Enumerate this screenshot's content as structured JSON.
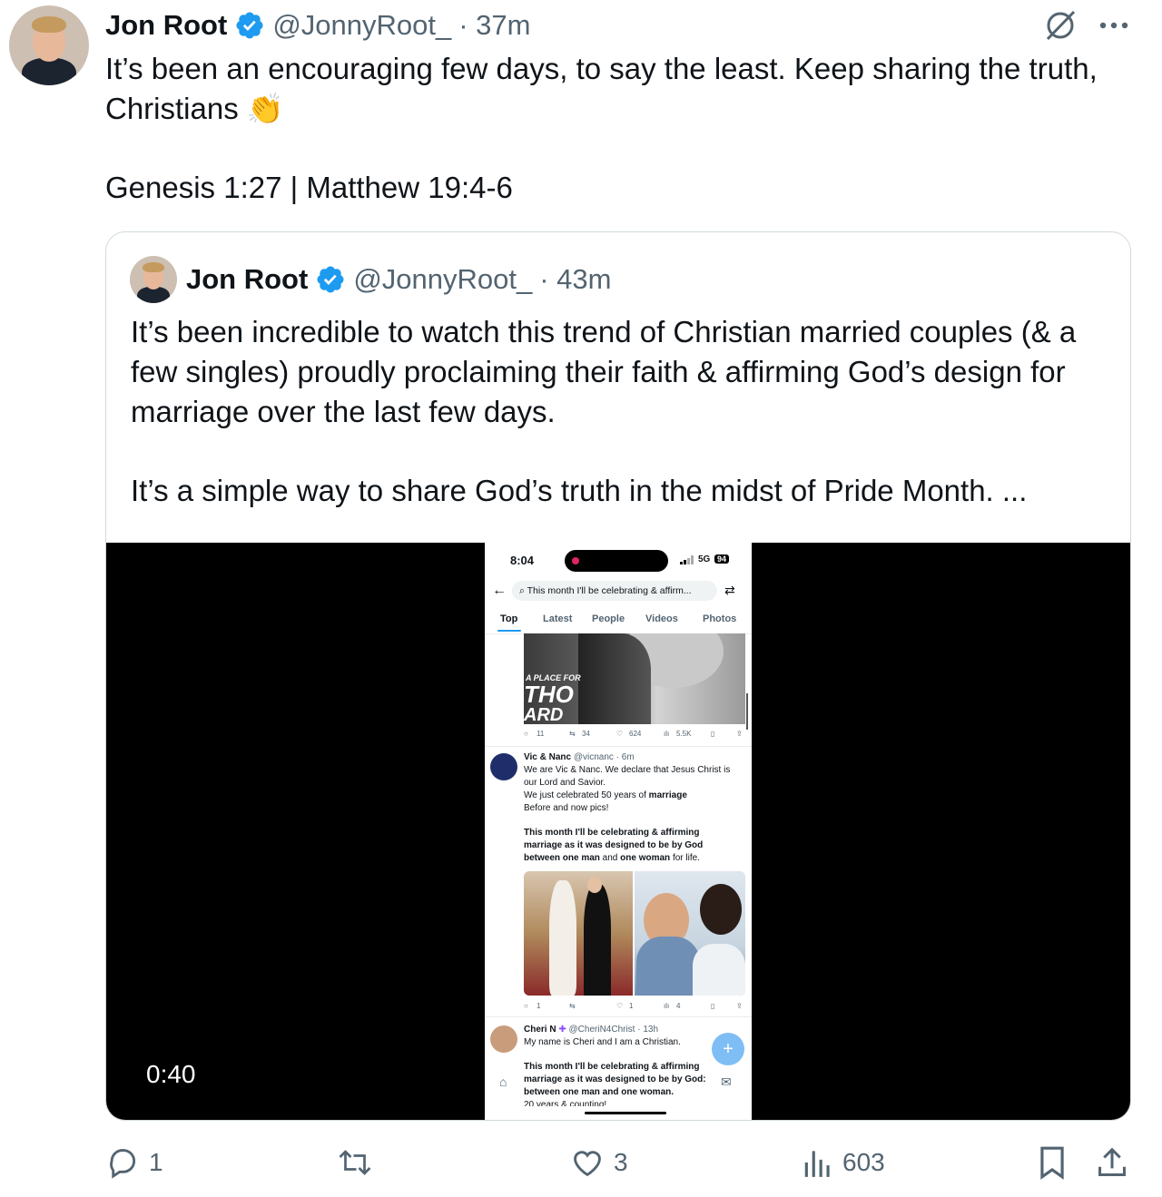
{
  "main_tweet": {
    "name": "Jon Root",
    "handle": "@JonnyRoot_",
    "time": "· 37m",
    "text_line1": "It’s been an encouraging few days, to say the least. Keep sharing the truth,",
    "text_line2": "Christians",
    "text_emoji": "👏",
    "verses": "Genesis 1:27 | Matthew 19:4-6"
  },
  "quoted_tweet": {
    "name": "Jon Root",
    "handle": "@JonnyRoot_",
    "time": "· 43m",
    "para1_l1": "It’s been incredible to watch this trend of Christian married couples (& a",
    "para1_l2": "few singles) proudly proclaiming their faith & affirming God’s design for",
    "para1_l3": "marriage over the last few days.",
    "para2": "It’s a simple way to share God’s truth in the midst of Pride Month.  ...",
    "video_duration": "0:40"
  },
  "phone": {
    "time": "8:04",
    "network": "5G",
    "battery": "94",
    "search": "This month I'll be celebrating & affirm...",
    "tabs": [
      "Top",
      "Latest",
      "People",
      "Videos",
      "Photos"
    ],
    "img_text1": "A PLACE FOR",
    "img_text2": "THO",
    "img_text3": "ARD",
    "post1_stats": {
      "replies": "11",
      "reposts": "34",
      "likes": "624",
      "views": "5.5K"
    },
    "post2": {
      "name": "Vic & Nanc",
      "meta": "@vicnanc · 6m",
      "l1": "We are Vic & Nanc. We declare that Jesus Christ is",
      "l2": "our Lord and Savior.",
      "l3a": "We just celebrated 50 years of ",
      "l3b": "marriage",
      "l4": "Before and now pics!",
      "b1": "This month I'll be celebrating & affirming",
      "b2": "marriage as it was designed to be by God",
      "b3a": "between one man",
      "b3b": " and ",
      "b3c": "one woman",
      "b3d": " for life.",
      "replies": "1",
      "likes": "1",
      "views": "4"
    },
    "post3": {
      "name": "Cheri N",
      "meta": "@CheriN4Christ · 13h",
      "l1": "My name is Cheri and I am a Christian.",
      "b1": "This month I'll be celebrating & affirming",
      "b2": "marriage as it was designed to be by God:",
      "b3": "between one man and one woman.",
      "cut": "20 years & counting!"
    }
  },
  "actions": {
    "replies": "1",
    "likes": "3",
    "views": "603"
  },
  "colors": {
    "accent": "#1d9bf0",
    "muted": "#536471",
    "border": "#cfd9de"
  }
}
